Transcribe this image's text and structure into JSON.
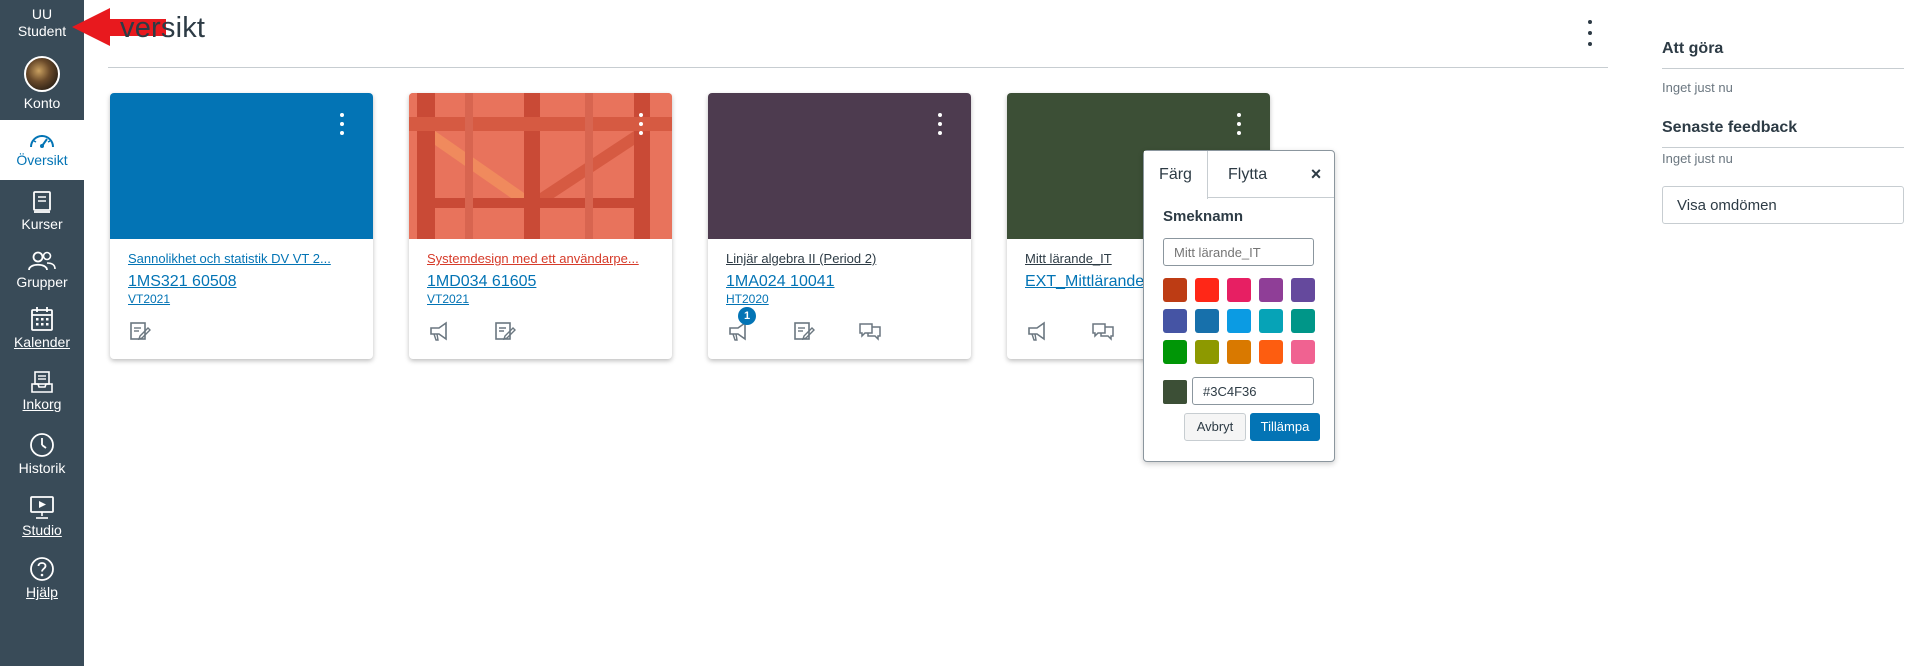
{
  "global_nav": {
    "logo_text_line1": "UU",
    "logo_text_line2": "Student",
    "items": [
      {
        "label": "Konto",
        "icon": "account-avatar"
      },
      {
        "label": "Översikt",
        "icon": "dashboard-icon"
      },
      {
        "label": "Kurser",
        "icon": "courses-icon"
      },
      {
        "label": "Grupper",
        "icon": "groups-icon"
      },
      {
        "label": "Kalender",
        "icon": "calendar-icon"
      },
      {
        "label": "Inkorg",
        "icon": "inbox-icon"
      },
      {
        "label": "Historik",
        "icon": "history-icon"
      },
      {
        "label": "Studio",
        "icon": "studio-icon"
      },
      {
        "label": "Hjälp",
        "icon": "help-icon"
      }
    ],
    "background": "#394b58",
    "active_color": "#0374b5"
  },
  "header": {
    "title": "versikt"
  },
  "cards": [
    {
      "title": "Sannolikhet och statistik DV VT 2...",
      "code": "1MS321 60508",
      "term": "VT2021",
      "color": "#0374b5",
      "title_color": "#0374b5",
      "icons": [
        "assignments-icon"
      ]
    },
    {
      "title": "Systemdesign med ett användarpe...",
      "code": "1MD034 61605",
      "term": "VT2021",
      "color": "#e8735c",
      "title_color": "#d63b2a",
      "icons": [
        "announcements-icon",
        "assignments-icon"
      ]
    },
    {
      "title": "Linjär algebra II (Period 2)",
      "code": "1MA024 10041",
      "term": "HT2020",
      "color": "#4d3b4f",
      "title_color": "#2d3b45",
      "icons": [
        "announcements-icon",
        "assignments-icon",
        "discussions-icon"
      ],
      "badge": "1"
    },
    {
      "title": "Mitt lärande_IT",
      "code": "EXT_Mittlärande",
      "term": "",
      "color": "#3c4f36",
      "title_color": "#2d3b45",
      "icons": [
        "announcements-icon",
        "discussions-icon"
      ]
    }
  ],
  "color_popover": {
    "tab_color": "Färg",
    "tab_move": "Flytta",
    "close": "×",
    "nickname_label": "Smeknamn",
    "nickname_placeholder": "Mitt lärande_IT",
    "swatches": [
      "#bd3c14",
      "#ff2717",
      "#e71f63",
      "#8f3e97",
      "#65499d",
      "#4554a4",
      "#1770ab",
      "#0b9be3",
      "#06a3b7",
      "#009688",
      "#009606",
      "#8d9900",
      "#d97900",
      "#fd5d10",
      "#f06291"
    ],
    "current_color": "#3C4F36",
    "hex_value": "#3C4F36",
    "cancel_label": "Avbryt",
    "apply_label": "Tillämpa"
  },
  "right_sidebar": {
    "todo_heading": "Att göra",
    "todo_text": "Inget just nu",
    "feedback_heading": "Senaste feedback",
    "feedback_text": "Inget just nu",
    "grades_button": "Visa omdömen"
  }
}
